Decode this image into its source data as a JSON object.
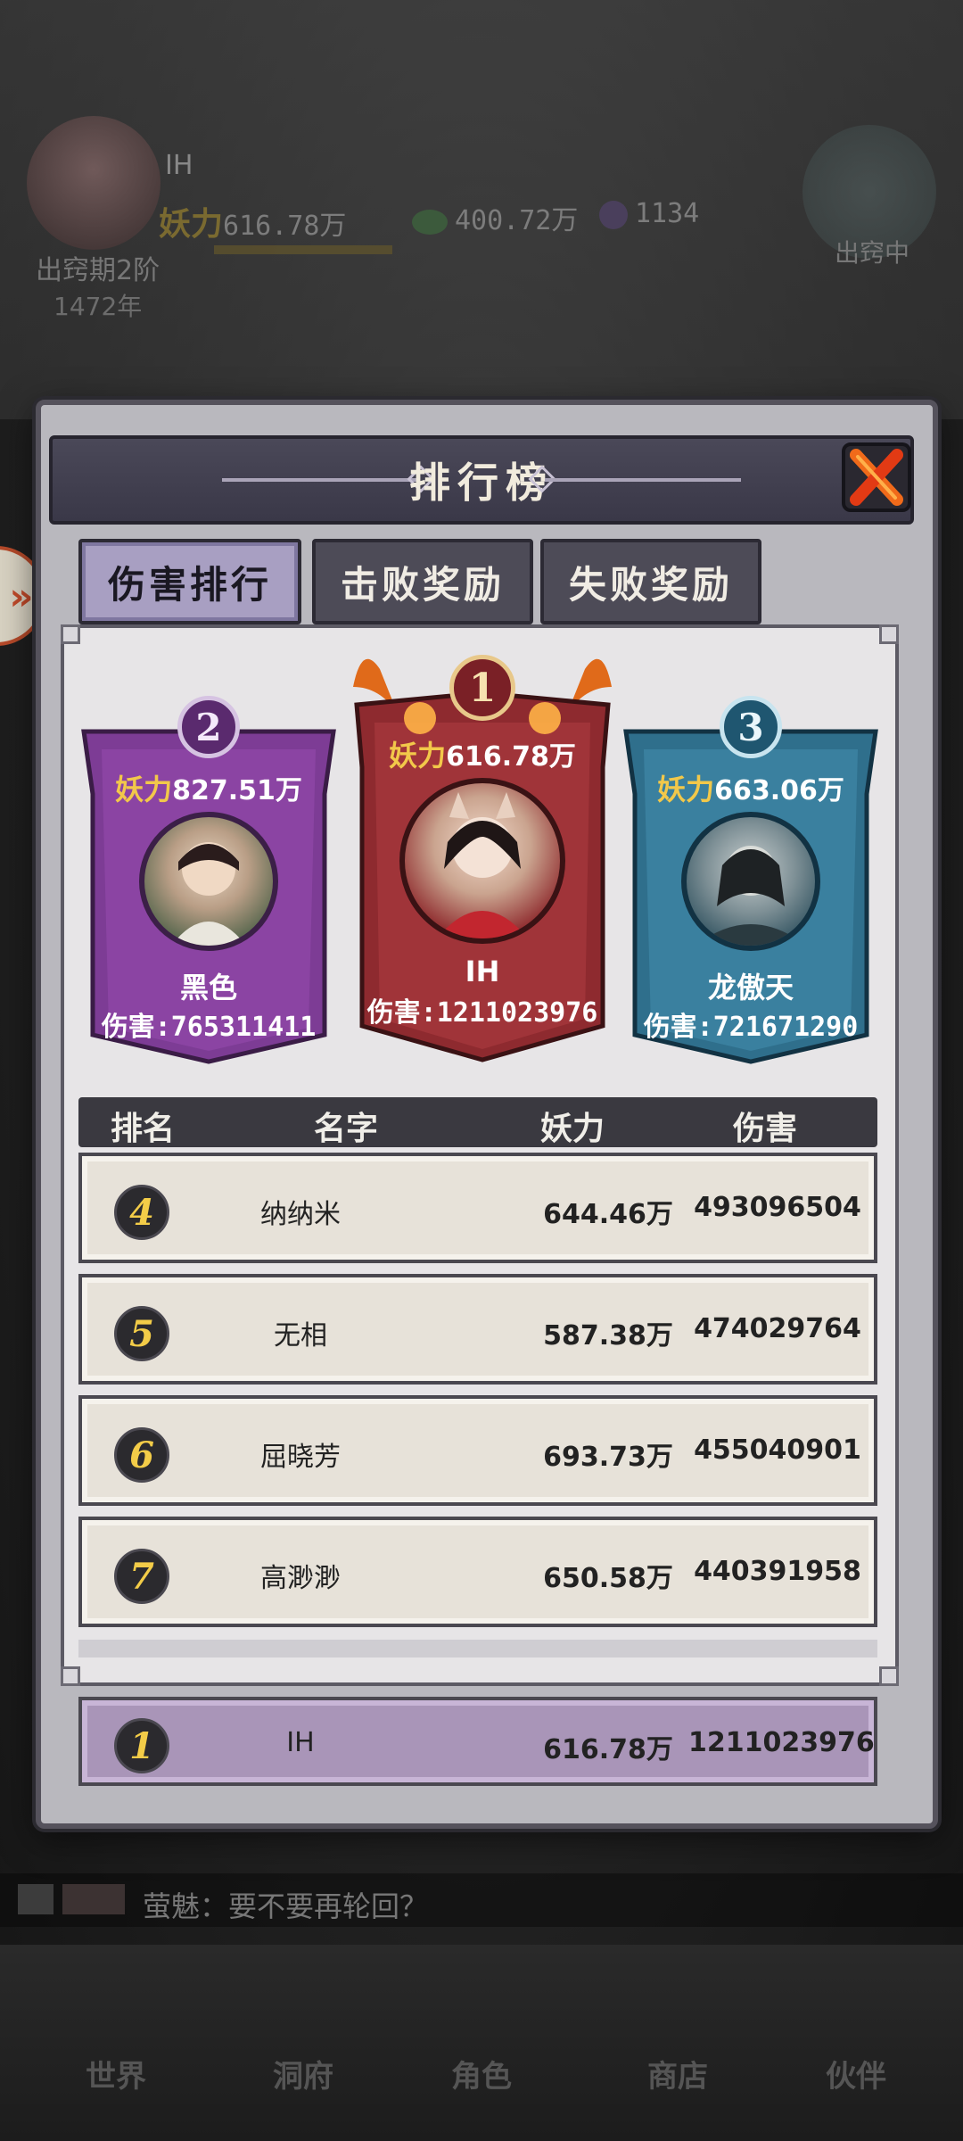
{
  "hud": {
    "player_name": "IH",
    "yaoli_label": "妖力",
    "yaoli_value": "616.78万",
    "gem_value": "400.72万",
    "orb_value": "1134",
    "stage": "出窍期2阶",
    "year": "1472年",
    "right_text": "出窍中"
  },
  "side_tab": {
    "icon": "»"
  },
  "panel": {
    "title": "排行榜",
    "tabs": [
      "伤害排行",
      "击败奖励",
      "失败奖励"
    ]
  },
  "podium": [
    {
      "rank": "1",
      "yaoli_label": "妖力",
      "yaoli": "616.78万",
      "name": "IH",
      "damage_label": "伤害:",
      "damage": "1211023976",
      "color": "#8e2a2f"
    },
    {
      "rank": "2",
      "yaoli_label": "妖力",
      "yaoli": "827.51万",
      "name": "黑色",
      "damage_label": "伤害:",
      "damage": "765311411",
      "color": "#7a3a92"
    },
    {
      "rank": "3",
      "yaoli_label": "妖力",
      "yaoli": "663.06万",
      "name": "龙傲天",
      "damage_label": "伤害:",
      "damage": "721671290",
      "color": "#2f6f8c"
    }
  ],
  "table": {
    "headers": [
      "排名",
      "名字",
      "妖力",
      "伤害"
    ],
    "rows": [
      {
        "rank": "4",
        "name": "纳纳米",
        "yaoli": "644.46万",
        "damage": "493096504"
      },
      {
        "rank": "5",
        "name": "无相",
        "yaoli": "587.38万",
        "damage": "474029764"
      },
      {
        "rank": "6",
        "name": "屈晓芳",
        "yaoli": "693.73万",
        "damage": "455040901"
      },
      {
        "rank": "7",
        "name": "高渺渺",
        "yaoli": "650.58万",
        "damage": "440391958"
      }
    ],
    "self_row": {
      "rank": "1",
      "name": "IH",
      "yaoli": "616.78万",
      "damage": "1211023976"
    }
  },
  "chat": {
    "text": "萤魅：要不要再轮回？"
  },
  "bottom_nav": [
    "世界",
    "洞府",
    "角色",
    "商店",
    "伙伴"
  ]
}
